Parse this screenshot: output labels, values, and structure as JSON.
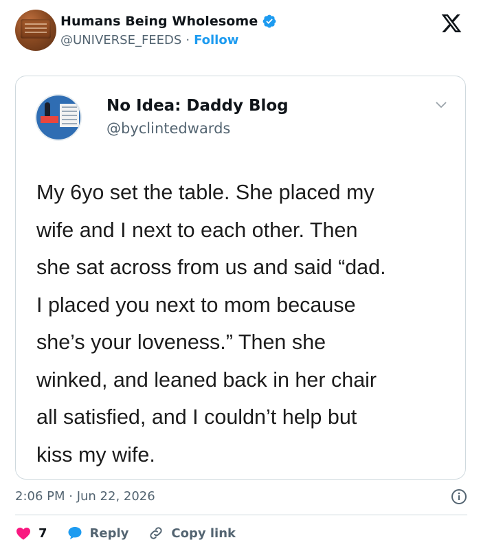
{
  "account": {
    "display_name": "Humans Being Wholesome",
    "handle": "@UNIVERSE_FEEDS",
    "separator": "·",
    "follow_label": "Follow",
    "verified_color": "#1d9bf0"
  },
  "quoted_tweet": {
    "display_name": "No Idea: Daddy Blog",
    "handle": "@byclintedwards",
    "text": "My 6yo set the table. She placed my\nwife and I next to each other. Then\nshe sat across from us and said “dad.\nI placed you next to mom because\nshe’s your loveness.” Then she\nwinked, and leaned back in her chair\nall satisfied, and I couldn’t help but\nkiss my wife."
  },
  "timestamp": "2:06 PM · Jun 22, 2026",
  "actions": {
    "like_count": "7",
    "reply_label": "Reply",
    "copy_link_label": "Copy link"
  },
  "icons": {
    "brand": "x-logo-icon",
    "verified": "verified-badge-icon",
    "like": "heart-icon",
    "reply": "reply-bubble-icon",
    "copy": "link-icon",
    "info": "info-icon",
    "menu": "chevron-down-icon"
  },
  "colors": {
    "accent": "#1d9bf0",
    "like": "#f91880",
    "muted": "#536471",
    "border": "#cfd9de"
  }
}
